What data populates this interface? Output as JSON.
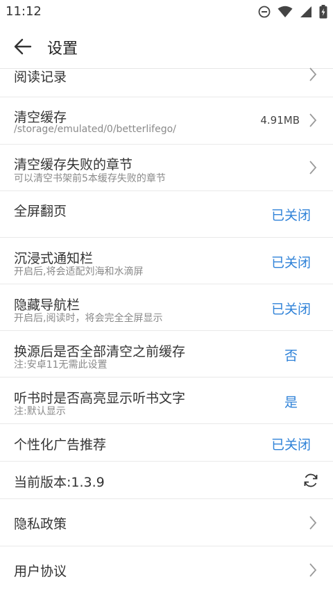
{
  "status_bar": {
    "time": "11:12"
  },
  "app_bar": {
    "title": "设置"
  },
  "settings": {
    "reading_history": {
      "title": "阅读记录"
    },
    "clear_cache": {
      "title": "清空缓存",
      "subtitle": "/storage/emulated/0/betterlifego/",
      "value": "4.91MB"
    },
    "clear_failed_chapters": {
      "title": "清空缓存失败的章节",
      "subtitle": "可以清空书架前5本缓存失败的章节"
    },
    "fullscreen_paging": {
      "title": "全屏翻页",
      "value": "已关闭"
    },
    "immersive_notification": {
      "title": "沉浸式通知栏",
      "subtitle": "开启后,将会适配刘海和水滴屏",
      "value": "已关闭"
    },
    "hide_navigation": {
      "title": "隐藏导航栏",
      "subtitle": "开启后,阅读时，将会完全全屏显示",
      "value": "已关闭"
    },
    "clear_cache_on_source_change": {
      "title": "换源后是否全部清空之前缓存",
      "subtitle": "注:安卓11无需此设置",
      "value": "否"
    },
    "highlight_listening_text": {
      "title": "听书时是否高亮显示听书文字",
      "subtitle": "注:默认显示",
      "value": "是"
    },
    "personalized_ads": {
      "title": "个性化广告推荐",
      "value": "已关闭"
    },
    "version": {
      "title": "当前版本:1.3.9"
    },
    "privacy_policy": {
      "title": "隐私政策"
    },
    "user_agreement": {
      "title": "用户协议"
    }
  },
  "colors": {
    "accent": "#2f82d8",
    "divider": "#e9e9e9",
    "subtitle": "#8a8a8a"
  }
}
